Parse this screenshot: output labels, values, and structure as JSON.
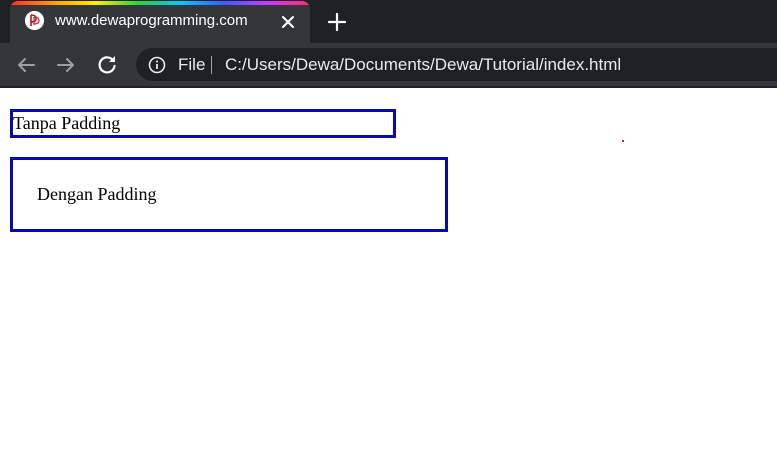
{
  "browser": {
    "tab": {
      "title": "www.dewaprogramming.com",
      "favicon": "dewaprogramming-logo",
      "close_icon": "close-icon"
    },
    "new_tab_icon": "plus-icon",
    "toolbar": {
      "back_icon": "arrow-left-icon",
      "forward_icon": "arrow-right-icon",
      "reload_icon": "reload-icon",
      "info_icon": "info-icon",
      "scheme_label": "File",
      "url": "C:/Users/Dewa/Documents/Dewa/Tutorial/index.html"
    },
    "colors": {
      "tab_strip_bg": "#202124",
      "active_tab_bg": "#35363a",
      "omnibox_bg": "#202124",
      "border_blue": "#0a0aa8"
    }
  },
  "page": {
    "box_no_padding": {
      "text": "Tanpa Padding"
    },
    "box_with_padding": {
      "text": "Dengan Padding"
    }
  }
}
